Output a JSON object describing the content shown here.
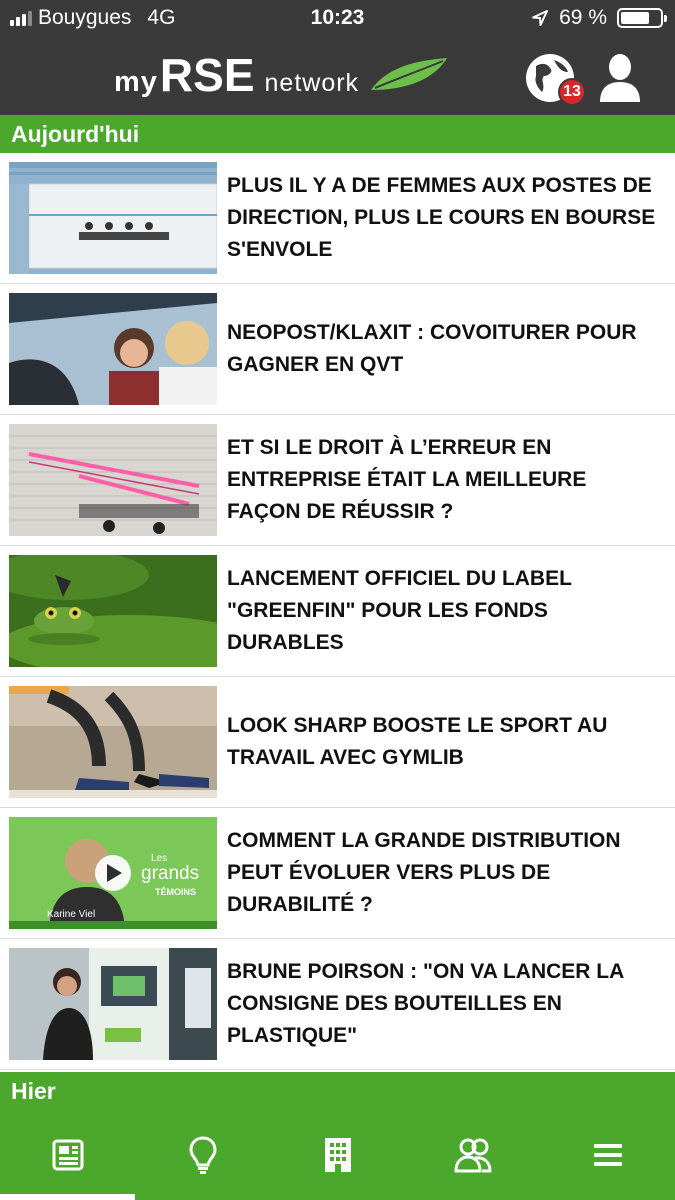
{
  "status_bar": {
    "carrier": "Bouygues",
    "network": "4G",
    "time": "10:23",
    "battery": "69 %"
  },
  "app_bar": {
    "logo_my": "my",
    "logo_rse": "RSE",
    "logo_network": "network",
    "notification_count": "13"
  },
  "sections": {
    "today": "Aujourd'hui",
    "yesterday": "Hier"
  },
  "articles": [
    {
      "title": "PLUS IL Y A DE FEMMES AUX POSTES DE DIRECTION, PLUS LE COURS EN BOURSE S'ENVOLE",
      "thumbnail": "office-meeting-room"
    },
    {
      "title": "NEOPOST/KLAXIT : COVOITURER POUR GAGNER EN QVT",
      "thumbnail": "carpool-women"
    },
    {
      "title": "ET SI LE DROIT À L’ERREUR EN ENTREPRISE ÉTAIT LA MEILLEURE FAÇON DE RÉUSSIR ?",
      "thumbnail": "neon-sign-brick-wall"
    },
    {
      "title": "LANCEMENT OFFICIEL DU LABEL \"GREENFIN\" POUR LES FONDS DURABLES",
      "thumbnail": "frog-butterfly"
    },
    {
      "title": "LOOK SHARP BOOSTE LE SPORT AU TRAVAIL AVEC GYMLIB",
      "thumbnail": "sneakers-heels"
    },
    {
      "title": "COMMENT LA GRANDE DISTRIBUTION PEUT ÉVOLUER VERS PLUS DE DURABILITÉ ?",
      "thumbnail": "video-les-grands-temoins",
      "video_caption_1": "Les",
      "video_caption_2": "grands",
      "video_caption_3": "TÉMOINS",
      "video_person": "Karine Viel"
    },
    {
      "title": "BRUNE POIRSON : \"ON VA LANCER LA CONSIGNE DES BOUTEILLES EN PLASTIQUE\"",
      "thumbnail": "recycling-machine"
    }
  ],
  "bottom_nav": [
    {
      "icon": "newspaper-icon",
      "active": true
    },
    {
      "icon": "lightbulb-icon",
      "active": false
    },
    {
      "icon": "building-icon",
      "active": false
    },
    {
      "icon": "community-icon",
      "active": false
    },
    {
      "icon": "menu-icon",
      "active": false
    }
  ],
  "colors": {
    "brand_green": "#4ba82c",
    "header_dark": "#3a3a3a",
    "badge_red": "#d8262a"
  }
}
